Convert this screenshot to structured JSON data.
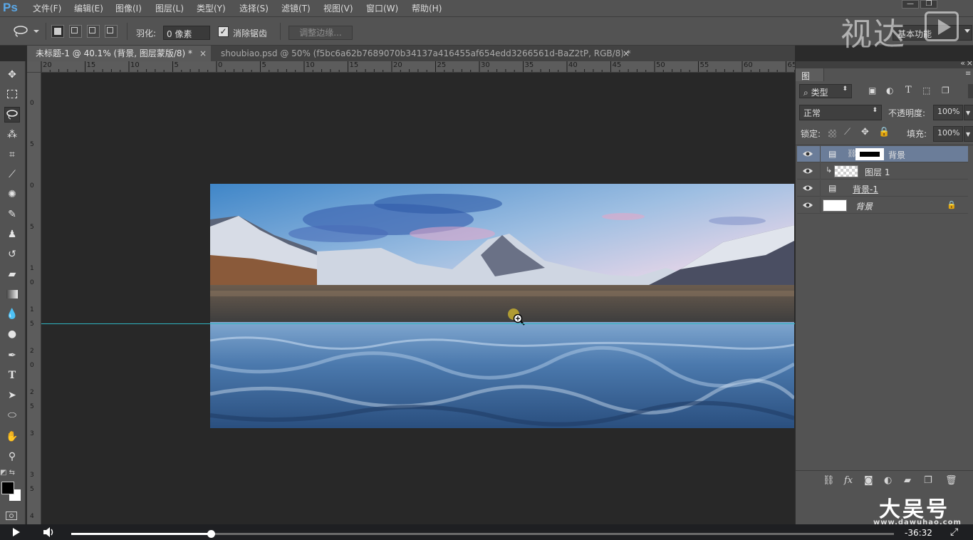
{
  "app": {
    "logo": "Ps"
  },
  "menu": [
    "文件(F)",
    "编辑(E)",
    "图像(I)",
    "图层(L)",
    "类型(Y)",
    "选择(S)",
    "滤镜(T)",
    "视图(V)",
    "窗口(W)",
    "帮助(H)"
  ],
  "window_buttons": [
    "—",
    "❐"
  ],
  "options": {
    "feather_label": "羽化:",
    "feather_value": "0 像素",
    "antialias_label": "消除锯齿",
    "antialias_checked": true,
    "refine_label": "调整边缘...",
    "workspace": "基本功能"
  },
  "tabs": [
    {
      "label": "未标题-1 @ 40.1% (背景, 图层蒙版/8) *",
      "active": true
    },
    {
      "label": "shoubiao.psd @ 50% (f5bc6a62b7689070b34137a416455af654edd3266561d-BaZ2tP, RGB/8) *",
      "active": false
    }
  ],
  "ruler_top": [
    "20",
    "15",
    "10",
    "5",
    "0",
    "5",
    "10",
    "15",
    "20",
    "25",
    "30",
    "35",
    "40",
    "45",
    "50",
    "55",
    "60",
    "65"
  ],
  "ruler_left": [
    "0",
    "5",
    "0",
    "5",
    "1 0",
    "1 5",
    "2 0",
    "2 5",
    "3",
    "3 5",
    "4"
  ],
  "layers_panel": {
    "title": "图层",
    "filter_kind": "类型",
    "blend_mode": "正常",
    "opacity_label": "不透明度:",
    "opacity_value": "100%",
    "lock_label": "锁定:",
    "fill_label": "填充:",
    "fill_value": "100%",
    "layers": [
      {
        "name": "背景",
        "selected": true,
        "has_mask": true,
        "visible": true
      },
      {
        "name": "图层 1",
        "selected": false,
        "clipped": true,
        "visible": true
      },
      {
        "name": "背景-1",
        "selected": false,
        "smart": true,
        "visible": true
      },
      {
        "name": "背景",
        "selected": false,
        "locked": true,
        "visible": true
      }
    ]
  },
  "watermark": {
    "top": "视达",
    "bottom": "大吴号",
    "url": "www.dawuhao.com"
  },
  "video": {
    "time": "-36:32",
    "progress": 0.17
  },
  "colors": {
    "accent": "#2fb3c0",
    "selected_layer": "#6b7d99",
    "panel_bg": "#535353"
  }
}
